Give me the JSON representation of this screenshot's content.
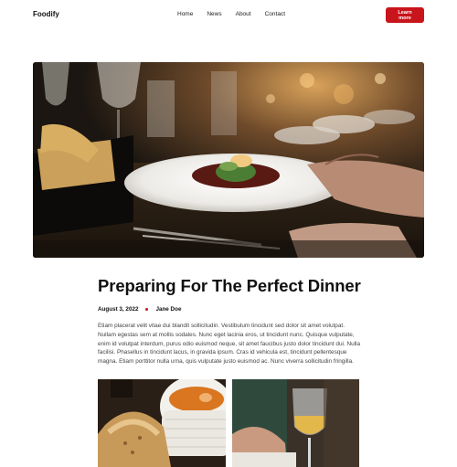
{
  "header": {
    "logo": "Foodify",
    "nav": [
      "Home",
      "News",
      "About",
      "Contact"
    ],
    "cta_label": "Learn more"
  },
  "article": {
    "title": "Preparing For The Perfect Dinner",
    "date": "August 3, 2022",
    "author": "Jane Doe",
    "body": "Etiam placerat velit vitae dui blandit sollicitudin. Vestibulum tincidunt sed dolor sit amet volutpat. Nullam egestas sem at mollis sodales. Nunc eget lacinia eros, ut tincidunt nunc. Quisque vulputate, enim id volutpat interdum, purus odio euismod neque, sit amet faucibus justo dolor tincidunt dui. Nulla facilisi. Phasellus in tincidunt lacus, in gravida ipsum. Cras id vehicula est, tincidunt pellentesque magna. Etiam porttitor nulla urna, quis vulputate justo euismod ac. Nunc viverra sollicitudin fringilla."
  },
  "colors": {
    "accent": "#c8151b",
    "text": "#111111",
    "body_text": "#444444"
  }
}
